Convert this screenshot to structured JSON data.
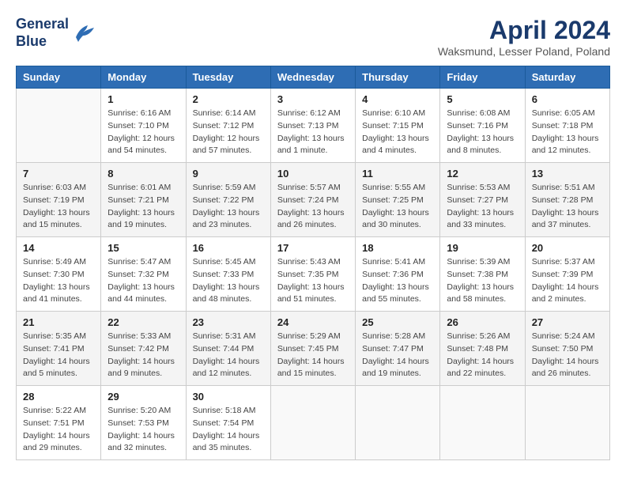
{
  "header": {
    "logo_line1": "General",
    "logo_line2": "Blue",
    "month_title": "April 2024",
    "location": "Waksmund, Lesser Poland, Poland"
  },
  "days_of_week": [
    "Sunday",
    "Monday",
    "Tuesday",
    "Wednesday",
    "Thursday",
    "Friday",
    "Saturday"
  ],
  "weeks": [
    [
      {
        "day": "",
        "sunrise": "",
        "sunset": "",
        "daylight": ""
      },
      {
        "day": "1",
        "sunrise": "Sunrise: 6:16 AM",
        "sunset": "Sunset: 7:10 PM",
        "daylight": "Daylight: 12 hours and 54 minutes."
      },
      {
        "day": "2",
        "sunrise": "Sunrise: 6:14 AM",
        "sunset": "Sunset: 7:12 PM",
        "daylight": "Daylight: 12 hours and 57 minutes."
      },
      {
        "day": "3",
        "sunrise": "Sunrise: 6:12 AM",
        "sunset": "Sunset: 7:13 PM",
        "daylight": "Daylight: 13 hours and 1 minute."
      },
      {
        "day": "4",
        "sunrise": "Sunrise: 6:10 AM",
        "sunset": "Sunset: 7:15 PM",
        "daylight": "Daylight: 13 hours and 4 minutes."
      },
      {
        "day": "5",
        "sunrise": "Sunrise: 6:08 AM",
        "sunset": "Sunset: 7:16 PM",
        "daylight": "Daylight: 13 hours and 8 minutes."
      },
      {
        "day": "6",
        "sunrise": "Sunrise: 6:05 AM",
        "sunset": "Sunset: 7:18 PM",
        "daylight": "Daylight: 13 hours and 12 minutes."
      }
    ],
    [
      {
        "day": "7",
        "sunrise": "Sunrise: 6:03 AM",
        "sunset": "Sunset: 7:19 PM",
        "daylight": "Daylight: 13 hours and 15 minutes."
      },
      {
        "day": "8",
        "sunrise": "Sunrise: 6:01 AM",
        "sunset": "Sunset: 7:21 PM",
        "daylight": "Daylight: 13 hours and 19 minutes."
      },
      {
        "day": "9",
        "sunrise": "Sunrise: 5:59 AM",
        "sunset": "Sunset: 7:22 PM",
        "daylight": "Daylight: 13 hours and 23 minutes."
      },
      {
        "day": "10",
        "sunrise": "Sunrise: 5:57 AM",
        "sunset": "Sunset: 7:24 PM",
        "daylight": "Daylight: 13 hours and 26 minutes."
      },
      {
        "day": "11",
        "sunrise": "Sunrise: 5:55 AM",
        "sunset": "Sunset: 7:25 PM",
        "daylight": "Daylight: 13 hours and 30 minutes."
      },
      {
        "day": "12",
        "sunrise": "Sunrise: 5:53 AM",
        "sunset": "Sunset: 7:27 PM",
        "daylight": "Daylight: 13 hours and 33 minutes."
      },
      {
        "day": "13",
        "sunrise": "Sunrise: 5:51 AM",
        "sunset": "Sunset: 7:28 PM",
        "daylight": "Daylight: 13 hours and 37 minutes."
      }
    ],
    [
      {
        "day": "14",
        "sunrise": "Sunrise: 5:49 AM",
        "sunset": "Sunset: 7:30 PM",
        "daylight": "Daylight: 13 hours and 41 minutes."
      },
      {
        "day": "15",
        "sunrise": "Sunrise: 5:47 AM",
        "sunset": "Sunset: 7:32 PM",
        "daylight": "Daylight: 13 hours and 44 minutes."
      },
      {
        "day": "16",
        "sunrise": "Sunrise: 5:45 AM",
        "sunset": "Sunset: 7:33 PM",
        "daylight": "Daylight: 13 hours and 48 minutes."
      },
      {
        "day": "17",
        "sunrise": "Sunrise: 5:43 AM",
        "sunset": "Sunset: 7:35 PM",
        "daylight": "Daylight: 13 hours and 51 minutes."
      },
      {
        "day": "18",
        "sunrise": "Sunrise: 5:41 AM",
        "sunset": "Sunset: 7:36 PM",
        "daylight": "Daylight: 13 hours and 55 minutes."
      },
      {
        "day": "19",
        "sunrise": "Sunrise: 5:39 AM",
        "sunset": "Sunset: 7:38 PM",
        "daylight": "Daylight: 13 hours and 58 minutes."
      },
      {
        "day": "20",
        "sunrise": "Sunrise: 5:37 AM",
        "sunset": "Sunset: 7:39 PM",
        "daylight": "Daylight: 14 hours and 2 minutes."
      }
    ],
    [
      {
        "day": "21",
        "sunrise": "Sunrise: 5:35 AM",
        "sunset": "Sunset: 7:41 PM",
        "daylight": "Daylight: 14 hours and 5 minutes."
      },
      {
        "day": "22",
        "sunrise": "Sunrise: 5:33 AM",
        "sunset": "Sunset: 7:42 PM",
        "daylight": "Daylight: 14 hours and 9 minutes."
      },
      {
        "day": "23",
        "sunrise": "Sunrise: 5:31 AM",
        "sunset": "Sunset: 7:44 PM",
        "daylight": "Daylight: 14 hours and 12 minutes."
      },
      {
        "day": "24",
        "sunrise": "Sunrise: 5:29 AM",
        "sunset": "Sunset: 7:45 PM",
        "daylight": "Daylight: 14 hours and 15 minutes."
      },
      {
        "day": "25",
        "sunrise": "Sunrise: 5:28 AM",
        "sunset": "Sunset: 7:47 PM",
        "daylight": "Daylight: 14 hours and 19 minutes."
      },
      {
        "day": "26",
        "sunrise": "Sunrise: 5:26 AM",
        "sunset": "Sunset: 7:48 PM",
        "daylight": "Daylight: 14 hours and 22 minutes."
      },
      {
        "day": "27",
        "sunrise": "Sunrise: 5:24 AM",
        "sunset": "Sunset: 7:50 PM",
        "daylight": "Daylight: 14 hours and 26 minutes."
      }
    ],
    [
      {
        "day": "28",
        "sunrise": "Sunrise: 5:22 AM",
        "sunset": "Sunset: 7:51 PM",
        "daylight": "Daylight: 14 hours and 29 minutes."
      },
      {
        "day": "29",
        "sunrise": "Sunrise: 5:20 AM",
        "sunset": "Sunset: 7:53 PM",
        "daylight": "Daylight: 14 hours and 32 minutes."
      },
      {
        "day": "30",
        "sunrise": "Sunrise: 5:18 AM",
        "sunset": "Sunset: 7:54 PM",
        "daylight": "Daylight: 14 hours and 35 minutes."
      },
      {
        "day": "",
        "sunrise": "",
        "sunset": "",
        "daylight": ""
      },
      {
        "day": "",
        "sunrise": "",
        "sunset": "",
        "daylight": ""
      },
      {
        "day": "",
        "sunrise": "",
        "sunset": "",
        "daylight": ""
      },
      {
        "day": "",
        "sunrise": "",
        "sunset": "",
        "daylight": ""
      }
    ]
  ]
}
